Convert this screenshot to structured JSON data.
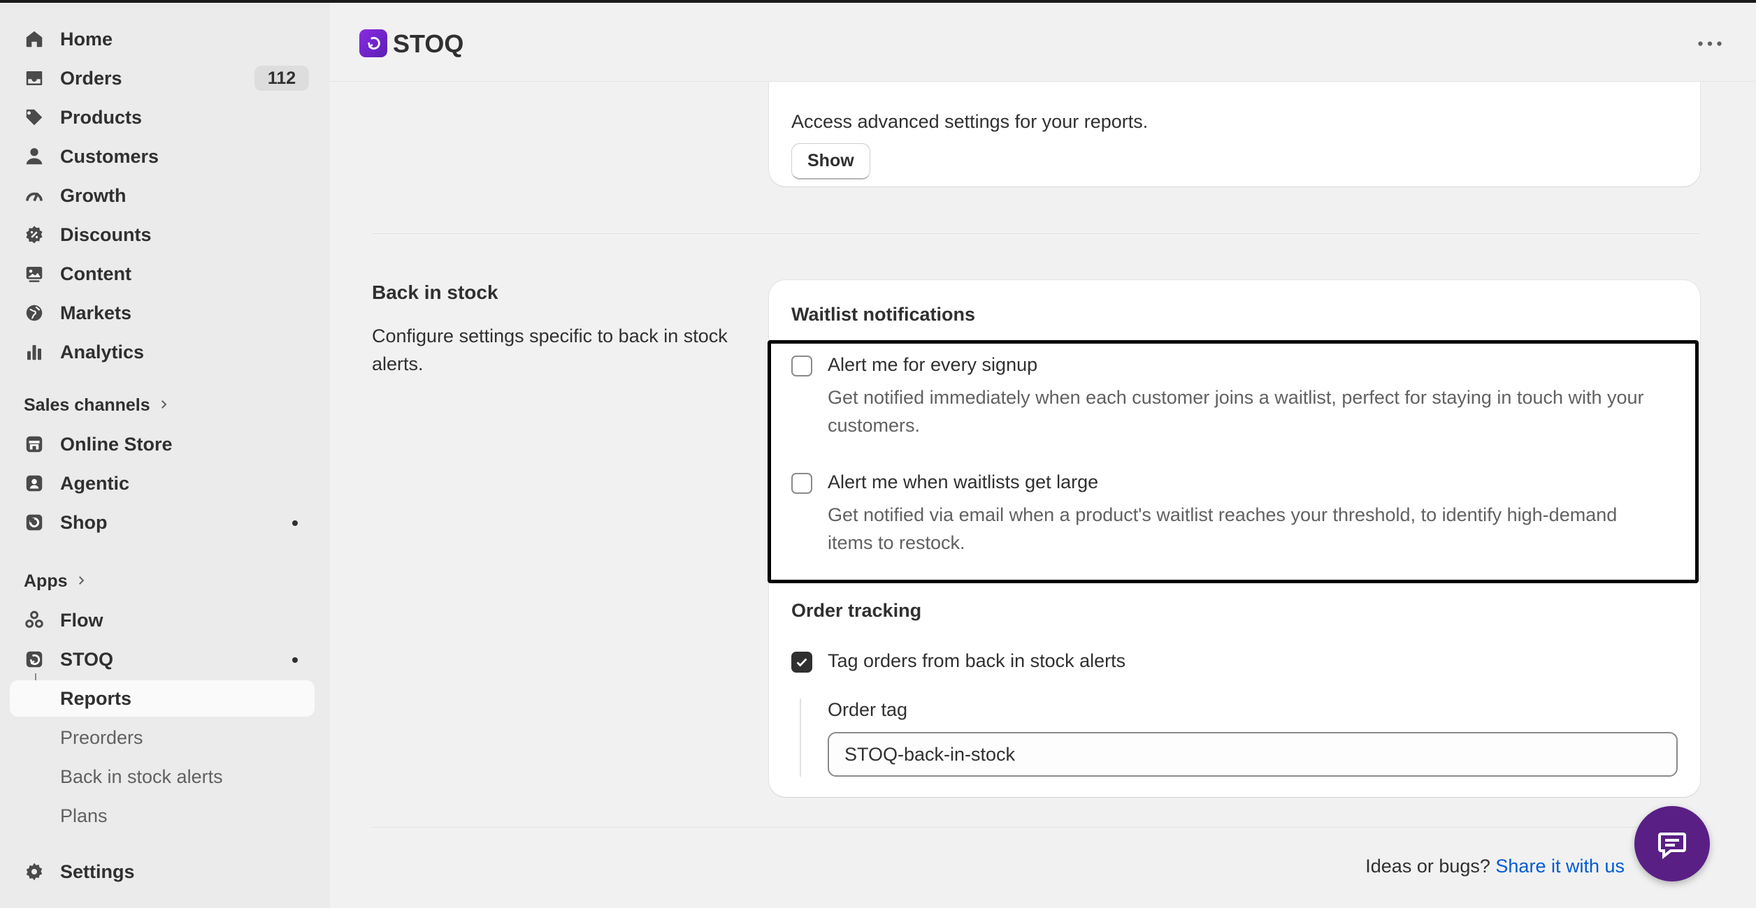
{
  "sidebar": {
    "main_items": [
      {
        "label": "Home",
        "icon": "home-icon"
      },
      {
        "label": "Orders",
        "icon": "inbox-icon",
        "badge": "112"
      },
      {
        "label": "Products",
        "icon": "tag-icon"
      },
      {
        "label": "Customers",
        "icon": "person-icon"
      },
      {
        "label": "Growth",
        "icon": "gauge-icon"
      },
      {
        "label": "Discounts",
        "icon": "discount-icon"
      },
      {
        "label": "Content",
        "icon": "image-icon"
      },
      {
        "label": "Markets",
        "icon": "globe-icon"
      },
      {
        "label": "Analytics",
        "icon": "bar-chart-icon"
      }
    ],
    "sales_channels_title": "Sales channels",
    "sales_channels": [
      {
        "label": "Online Store",
        "icon": "store-icon"
      },
      {
        "label": "Agentic",
        "icon": "agent-icon"
      },
      {
        "label": "Shop",
        "icon": "shop-icon"
      }
    ],
    "apps_title": "Apps",
    "apps": [
      {
        "label": "Flow",
        "icon": "flow-icon"
      },
      {
        "label": "STOQ",
        "icon": "stoq-icon"
      }
    ],
    "stoq_subitems": [
      "Reports",
      "Preorders",
      "Back in stock alerts",
      "Plans"
    ],
    "settings_label": "Settings"
  },
  "topbar": {
    "app_name": "STOQ",
    "brand_color": "#6d28d9"
  },
  "advanced": {
    "description": "Access advanced settings for your reports.",
    "show_button": "Show"
  },
  "back_in_stock": {
    "title": "Back in stock",
    "description": "Configure settings specific to back in stock alerts.",
    "waitlist_heading": "Waitlist notifications",
    "options": [
      {
        "label": "Alert me for every signup",
        "help": "Get notified immediately when each customer joins a waitlist, perfect for staying in touch with your customers.",
        "checked": false
      },
      {
        "label": "Alert me when waitlists get large",
        "help": "Get notified via email when a product's waitlist reaches your threshold, to identify high-demand items to restock.",
        "checked": false
      }
    ],
    "order_tracking_heading": "Order tracking",
    "tag_orders_label": "Tag orders from back in stock alerts",
    "tag_orders_checked": true,
    "order_tag_label": "Order tag",
    "order_tag_value": "STOQ-back-in-stock"
  },
  "footer": {
    "prefix": "Ideas or bugs?",
    "link": "Share it with us"
  }
}
